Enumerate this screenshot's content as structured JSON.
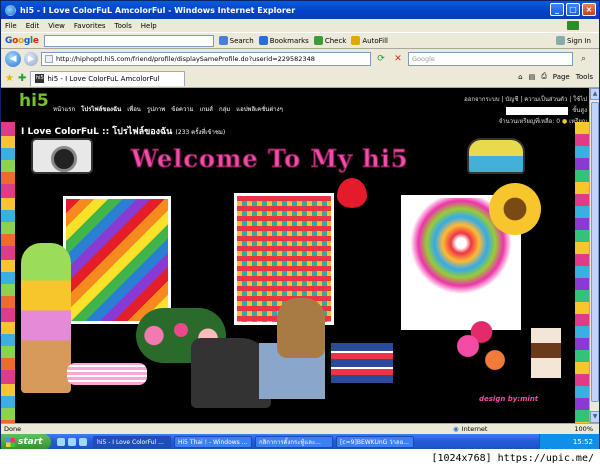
{
  "window": {
    "title": "hi5 - I Love ColorFuL AmcolorFul - Windows Internet Explorer",
    "buttons": [
      "_",
      "□",
      "×"
    ]
  },
  "menu": [
    "File",
    "Edit",
    "View",
    "Favorites",
    "Tools",
    "Help"
  ],
  "google_bar": {
    "logo": "Google",
    "search_label": "Search",
    "bookmarks_label": "Bookmarks",
    "check_label": "Check",
    "autofill_label": "AutoFill",
    "signin_label": "Sign In"
  },
  "address": {
    "url": "http://hiphoptl.hi5.com/friend/profile/displaySameProfile.do?userid=229582348",
    "live_search_placeholder": "Google"
  },
  "tabs": [
    {
      "label": "hi5 - I Love ColorFuL AmcolorFul"
    }
  ],
  "tab_tools": {
    "page": "Page",
    "tools": "Tools"
  },
  "hi5": {
    "logo": "hi5",
    "nav": [
      "หน้าแรก",
      "โปรไฟล์ของฉัน",
      "เพื่อน",
      "รูปภาพ",
      "ข้อความ",
      "เกมส์",
      "กลุ่ม",
      "แอปพลิเคชั่นต่างๆ"
    ],
    "right_top": "ออกจากระบบ | บัญชี | ความเป็นส่วนตัว | ใช้ไป",
    "search_button": "ขั้นสูง",
    "coins": "จำนวนเหรียญที่เหลือ: 0",
    "coins_link": "เหรียญ"
  },
  "profile": {
    "title": "I Love ColorFuL :: โปรไฟล์ของฉัน",
    "views": "(233 ครั้งที่เข้าชม)",
    "banner": "Welcome To My hi5",
    "credit": "design by:mint"
  },
  "status": {
    "text": "Done",
    "zone": "Internet",
    "zoom": "100%"
  },
  "taskbar": {
    "start": "start",
    "tasks": [
      "hi5 - I Love ColorFul ...",
      "Hi5 Thai ! - Windows ...",
      "กลิกาการตั้งกระทู้และ...",
      "[c=9]BEWKUnG ว่าลอ..."
    ],
    "clock": "15:52"
  },
  "watermark": "[1024x768] https://upic.me/"
}
